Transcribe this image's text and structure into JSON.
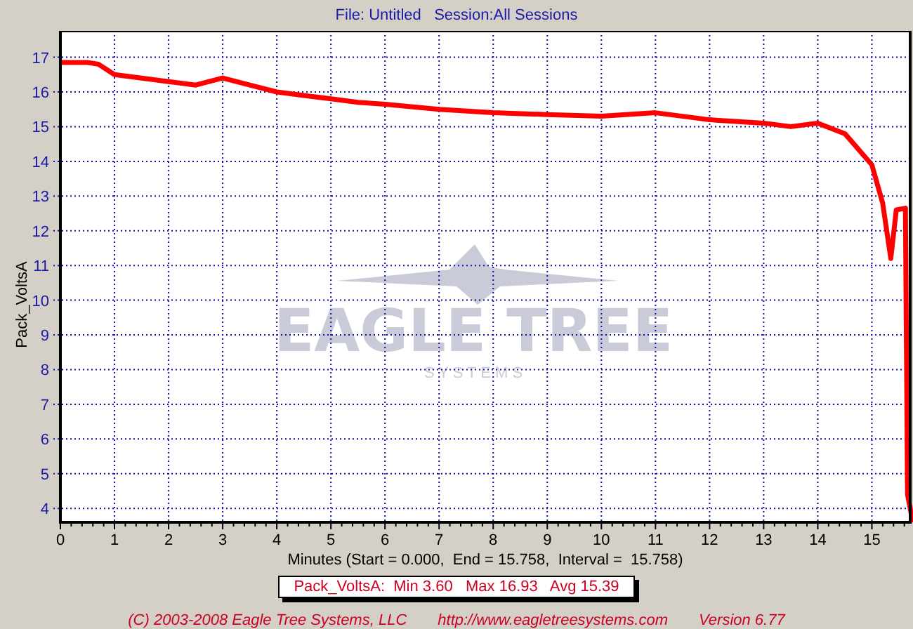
{
  "header": {
    "title": "File: Untitled   Session:All Sessions"
  },
  "chart": {
    "logo": {
      "name": "EAGLE TREE",
      "tagline": "S Y S T E M S"
    },
    "chart_data": {
      "type": "line",
      "grid": true,
      "xlabel": "Minutes (Start = 0.000,  End = 15.758,  Interval =  15.758)",
      "ylabel": "Pack_VoltsA",
      "xlim": [
        0,
        15.76
      ],
      "ylim": [
        3.6,
        17.76
      ],
      "xticks": [
        0,
        1,
        2,
        3,
        4,
        5,
        6,
        7,
        8,
        9,
        10,
        11,
        12,
        13,
        14,
        15
      ],
      "yticks": [
        4,
        5,
        6,
        7,
        8,
        9,
        10,
        11,
        12,
        13,
        14,
        15,
        16,
        17
      ],
      "x": [
        0,
        0.5,
        0.7,
        1,
        1.5,
        2,
        2.5,
        3,
        3.5,
        4,
        4.5,
        5,
        5.5,
        6,
        7,
        8,
        9,
        10,
        11,
        12,
        13,
        13.5,
        14,
        14.5,
        15,
        15.2,
        15.35,
        15.45,
        15.62,
        15.66,
        15.72,
        15.758
      ],
      "series": [
        {
          "name": "Pack_VoltsA",
          "color": "#ff0000",
          "values": [
            16.85,
            16.85,
            16.8,
            16.5,
            16.4,
            16.3,
            16.2,
            16.4,
            16.2,
            16.0,
            15.9,
            15.8,
            15.7,
            15.65,
            15.5,
            15.4,
            15.35,
            15.3,
            15.4,
            15.2,
            15.1,
            15.0,
            15.1,
            14.8,
            13.9,
            12.8,
            11.2,
            12.6,
            12.65,
            4.4,
            3.9,
            3.6
          ]
        }
      ]
    }
  },
  "legend": {
    "text": ":  Min 3.60   Max 16.93   Avg 15.39"
  },
  "footer": [
    {
      "text": "(C) 2003-2008 Eagle Tree Systems, LLC"
    },
    {
      "text": "http://www.eagletreesystems.com"
    },
    {
      "text": "Version 6.77"
    }
  ]
}
